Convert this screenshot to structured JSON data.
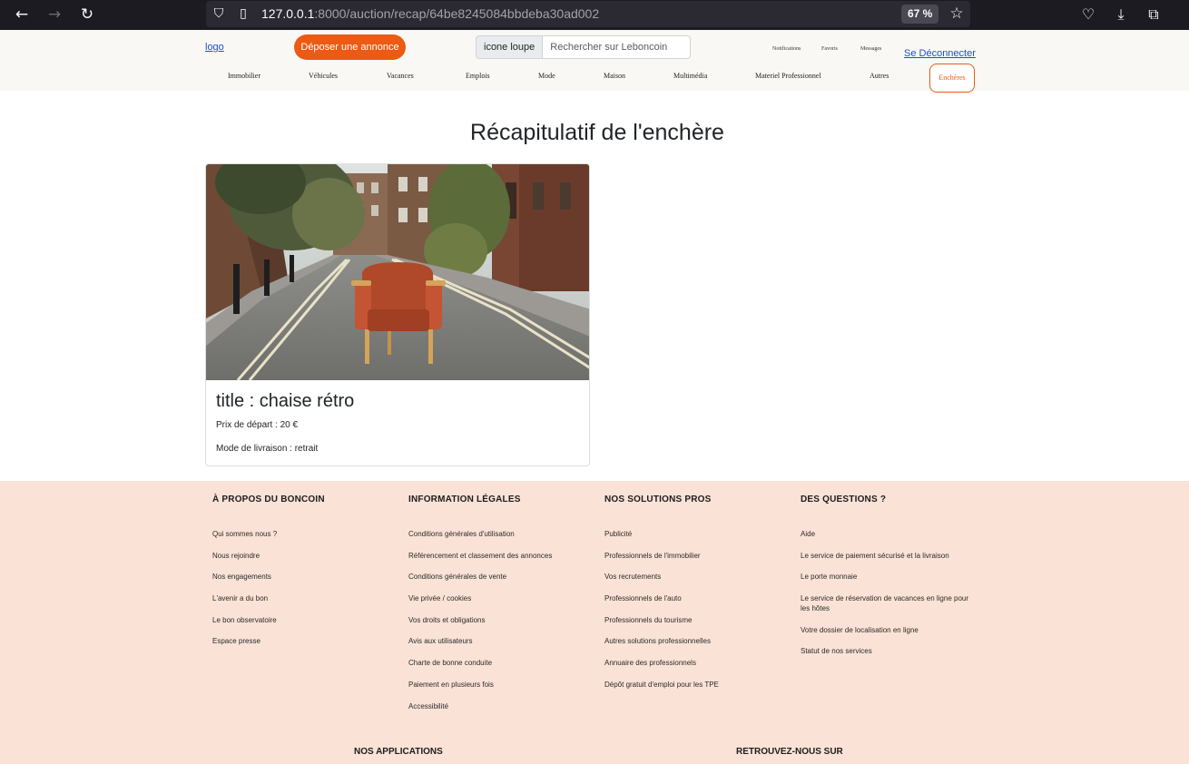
{
  "browser": {
    "url_host": "127.0.0.1",
    "url_path": ":8000/auction/recap/64be8245084bbdeba30ad002",
    "zoom": "67 %"
  },
  "header": {
    "logo": "logo",
    "post_ad": "Déposer une annonce",
    "search_addon": "icone loupe",
    "search_placeholder": "Rechercher sur Leboncoin",
    "notifications": "Notifications",
    "favorites": "Favoris",
    "messages": "Messages",
    "logout": "Se Déconnecter",
    "categories": [
      "Immobilier",
      "Véhicules",
      "Vacances",
      "Emplois",
      "Mode",
      "Maison",
      "Multimédia",
      "Materiel Professionnel",
      "Autres"
    ],
    "auction_tab": "Enchères"
  },
  "main": {
    "title": "Récapitulatif de l'enchère",
    "card": {
      "title": "title : chaise rétro",
      "start_price": "Prix de départ : 20 €",
      "delivery": "Mode de livraison : retrait"
    }
  },
  "footer": {
    "columns": [
      {
        "heading": "À PROPOS DU BONCOIN",
        "links": [
          "Qui sommes nous ?",
          "Nous rejoindre",
          "Nos engagements",
          "L'avenir a du bon",
          "Le bon observatoire",
          "Espace presse"
        ]
      },
      {
        "heading": "INFORMATION LÉGALES",
        "links": [
          "Conditions générales d'utilisation",
          "Référencement et classement des annonces",
          "Conditions générales de vente",
          "Vie privée / cookies",
          "Vos droits et obligations",
          "Avis aux utilisateurs",
          "Charte de bonne conduite",
          "Paiement en plusieurs fois",
          "Accessibilité"
        ]
      },
      {
        "heading": "NOS SOLUTIONS PROS",
        "links": [
          "Publicité",
          "Professionnels de l'immobilier",
          "Vos recrutements",
          "Professionnels de l'auto",
          "Professionnels du tourisme",
          "Autres solutions professionnelles",
          "Annuaire des professionnels",
          "Dépôt gratuit d'emploi pour les TPE"
        ]
      },
      {
        "heading": "DES QUESTIONS ?",
        "links": [
          "Aide",
          "Le service de paiement sécurisé et la livraison",
          "Le porte monnaie",
          "Le service de réservation de vacances en ligne pour les hôtes",
          "Votre dossier de localisation en ligne",
          "Statut de nos services"
        ]
      }
    ],
    "apps_heading": "NOS APPLICATIONS",
    "follow_heading": "RETROUVEZ-NOUS SUR"
  },
  "colors": {
    "accent": "#ec5a13",
    "footer_bg": "#fbe2d6",
    "header_bg": "#faf8f4",
    "link": "#1a4fd6"
  },
  "icons": [
    "back-arrow-icon",
    "forward-arrow-icon",
    "reload-icon",
    "shield-icon",
    "page-icon",
    "star-icon",
    "pocket-icon",
    "download-icon",
    "extensions-icon"
  ]
}
